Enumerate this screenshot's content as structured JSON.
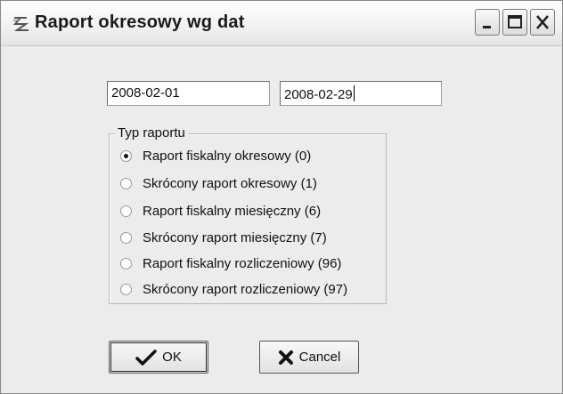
{
  "window": {
    "title": "Raport okresowy wg dat"
  },
  "dates": {
    "from_value": "2008-02-01",
    "to_value": "2008-02-29"
  },
  "report_type": {
    "legend": "Typ raportu",
    "selected_index": 0,
    "options": [
      "Raport fiskalny okresowy (0)",
      "Skrócony raport okresowy (1)",
      "Raport fiskalny miesięczny (6)",
      "Skrócony raport miesięczny (7)",
      "Raport fiskalny rozliczeniowy (96)",
      "Skrócony raport rozliczeniowy (97)"
    ]
  },
  "buttons": {
    "ok_label": "OK",
    "cancel_label": "Cancel"
  },
  "icons": {
    "app": "app-icon",
    "minimize": "minimize-icon",
    "maximize": "maximize-icon",
    "close": "close-icon",
    "ok": "checkmark-icon",
    "cancel": "x-icon"
  }
}
